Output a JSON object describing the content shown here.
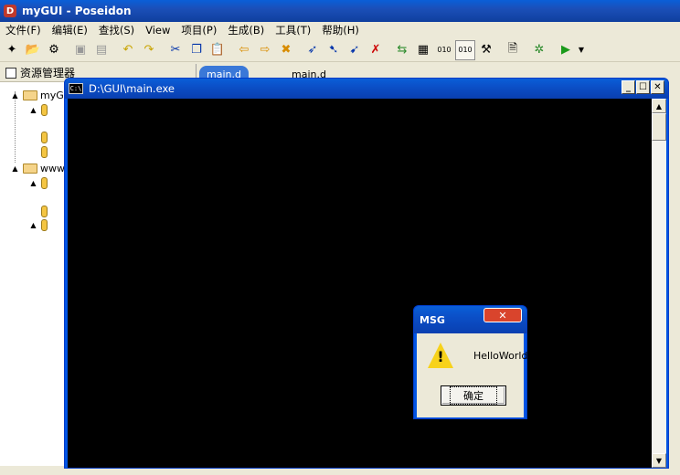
{
  "ide": {
    "title": "myGUI - Poseidon",
    "logo": "D"
  },
  "menu": [
    "文件(F)",
    "编辑(E)",
    "查找(S)",
    "View",
    "项目(P)",
    "生成(B)",
    "工具(T)",
    "帮助(H)"
  ],
  "left_pane": {
    "title": "资源管理器",
    "tree": [
      {
        "label": "myG",
        "type": "folder"
      },
      {
        "label": "www",
        "type": "folder"
      }
    ]
  },
  "tabs": [
    "main.d",
    "main.d"
  ],
  "console": {
    "title": "D:\\GUI\\main.exe",
    "icon": "C:\\"
  },
  "msgbox": {
    "title": "MSG",
    "close_label": "✕",
    "message": "HelloWorld",
    "ok_label": "确定"
  }
}
